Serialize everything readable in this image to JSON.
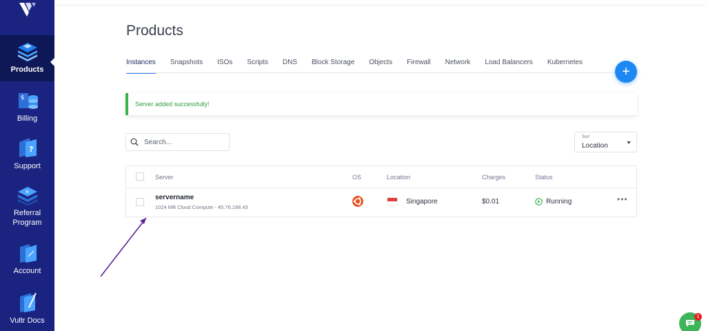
{
  "sidebar": {
    "items": [
      {
        "label": "Products",
        "icon": "products-icon"
      },
      {
        "label": "Billing",
        "icon": "billing-icon"
      },
      {
        "label": "Support",
        "icon": "support-icon"
      },
      {
        "label": "Referral Program",
        "icon": "referral-icon"
      },
      {
        "label": "Account",
        "icon": "account-icon"
      },
      {
        "label": "Vultr Docs",
        "icon": "docs-icon"
      }
    ]
  },
  "page": {
    "title": "Products",
    "tabs": [
      "Instances",
      "Snapshots",
      "ISOs",
      "Scripts",
      "DNS",
      "Block Storage",
      "Objects",
      "Firewall",
      "Network",
      "Load Balancers",
      "Kubernetes"
    ],
    "active_tab": "Instances"
  },
  "alert": {
    "message": "Server added successfully!"
  },
  "search": {
    "placeholder": "Search..."
  },
  "sort": {
    "caption": "Sort",
    "value": "Location"
  },
  "table": {
    "headers": {
      "server": "Server",
      "os": "OS",
      "location": "Location",
      "charges": "Charges",
      "status": "Status"
    },
    "rows": [
      {
        "name": "servername",
        "details": "1024 MB Cloud Compute - 45.76.188.43",
        "os": "ubuntu-icon",
        "location": "Singapore",
        "charges": "$0.01",
        "status": "Running"
      }
    ]
  },
  "chat": {
    "badge": "1"
  },
  "colors": {
    "sidebar": "#1a2480",
    "accent": "#1e88f2",
    "success": "#3bb14a"
  }
}
